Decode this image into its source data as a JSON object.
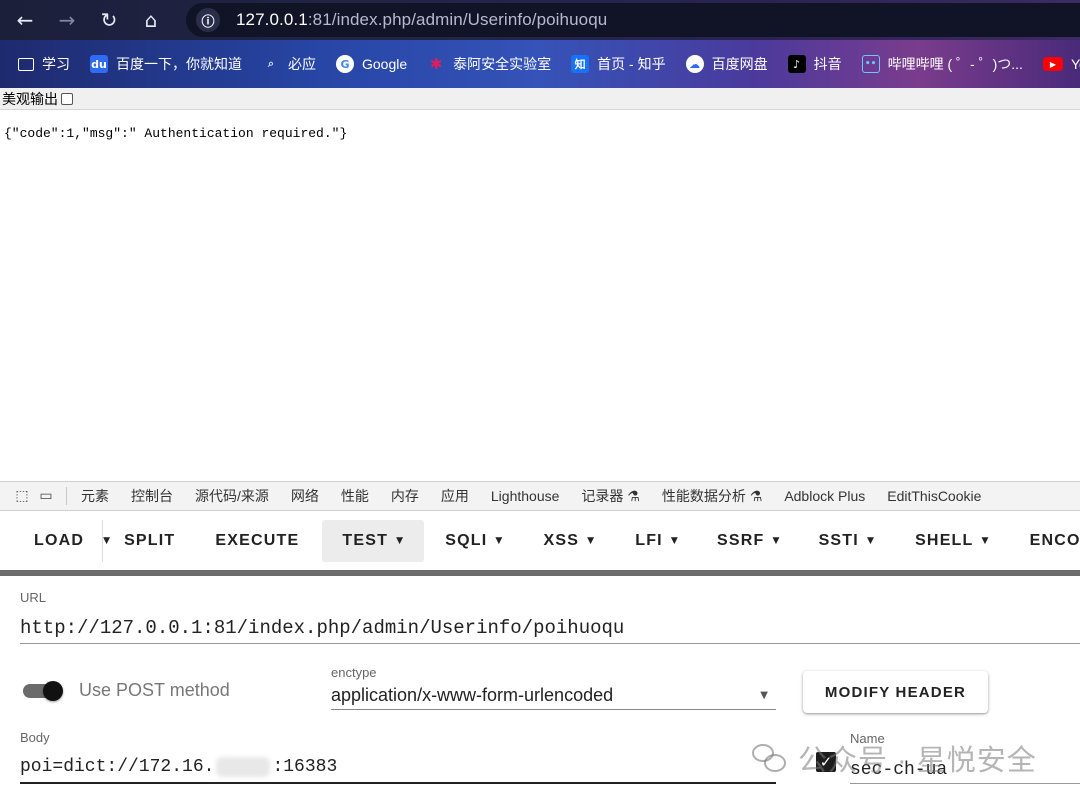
{
  "browser": {
    "url_host": "127.0.0.1",
    "url_rest": ":81/index.php/admin/Userinfo/poihuoqu",
    "bookmarks": [
      {
        "label": "学习",
        "icon": "folder-icon",
        "color": "transparent"
      },
      {
        "label": "百度一下，你就知道",
        "icon": "baidu-icon",
        "color": "#2f6cf5"
      },
      {
        "label": "必应",
        "icon": "search-icon",
        "color": "transparent"
      },
      {
        "label": "Google",
        "icon": "google-icon",
        "color": "#ffffff"
      },
      {
        "label": "泰阿安全实验室",
        "icon": "slack-icon",
        "color": "transparent"
      },
      {
        "label": "首页 - 知乎",
        "icon": "zhihu-icon",
        "color": "#1772f6"
      },
      {
        "label": "百度网盘",
        "icon": "baidu-pan-icon",
        "color": "#ffffff"
      },
      {
        "label": "抖音",
        "icon": "douyin-icon",
        "color": "#000000"
      },
      {
        "label": "哔哩哔哩 ( ゜- ゜)つ...",
        "icon": "bilibili-icon",
        "color": "transparent"
      },
      {
        "label": "You",
        "icon": "youtube-icon",
        "color": "#ff0000"
      }
    ]
  },
  "page": {
    "pretty_label": "美观输出",
    "json_output": "{\"code\":1,\"msg\":\" Authentication required.\"}"
  },
  "devtools": {
    "tabs": [
      "元素",
      "控制台",
      "源代码/来源",
      "网络",
      "性能",
      "内存",
      "应用",
      "Lighthouse",
      "记录器 ⚗",
      "性能数据分析 ⚗",
      "Adblock Plus",
      "EditThisCookie"
    ]
  },
  "hackbar": {
    "buttons": {
      "load": "LOAD",
      "split": "SPLIT",
      "execute": "EXECUTE",
      "test": "TEST",
      "sqli": "SQLI",
      "xss": "XSS",
      "lfi": "LFI",
      "ssrf": "SSRF",
      "ssti": "SSTI",
      "shell": "SHELL",
      "encoding": "ENCODING"
    },
    "url_label": "URL",
    "url_value": "http://127.0.0.1:81/index.php/admin/Userinfo/poihuoqu",
    "use_post_label": "Use POST method",
    "use_post_enabled": true,
    "enctype_label": "enctype",
    "enctype_value": "application/x-www-form-urlencoded",
    "modify_header": "MODIFY HEADER",
    "body_label": "Body",
    "body_prefix": "poi=dict://172.16.",
    "body_suffix": ":16383",
    "header_name_label": "Name",
    "header_name_value": "sec-ch-ua",
    "header_enabled": true
  },
  "watermark": {
    "text": "公众号 · 星悦安全"
  }
}
